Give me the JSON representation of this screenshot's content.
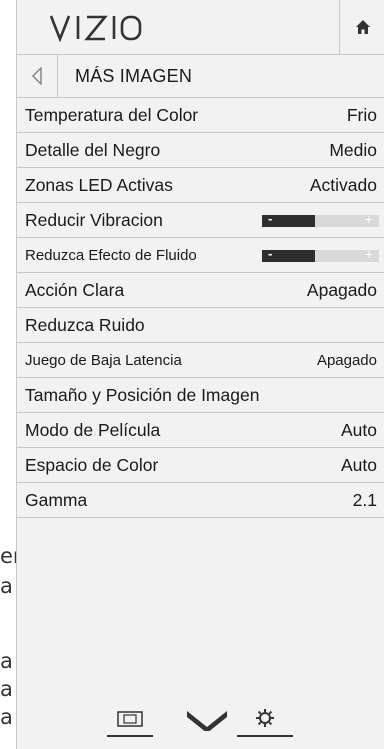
{
  "background_text": [
    "er",
    "a",
    "",
    "a",
    "a",
    "a"
  ],
  "header": {
    "logo_text": "VIZIO",
    "home_icon": "home-icon"
  },
  "subheader": {
    "back_icon": "back-arrow-icon",
    "title": "MÁS IMAGEN"
  },
  "menu": {
    "items": [
      {
        "label": "Temperatura del Color",
        "value": "Frio"
      },
      {
        "label": "Detalle del Negro",
        "value": "Medio"
      },
      {
        "label": "Zonas LED Activas",
        "value": "Activado"
      },
      {
        "label": "Reducir Vibracion",
        "slider": 0.45
      },
      {
        "label": "Reduzca Efecto de Fluido",
        "slider": 0.45
      },
      {
        "label": "Acción Clara",
        "value": "Apagado"
      },
      {
        "label": "Reduzca Ruido",
        "value": ""
      },
      {
        "label": "Juego de Baja Latencia",
        "value": "Apagado"
      },
      {
        "label": "Tamaño y Posición de Imagen",
        "value": ""
      },
      {
        "label": "Modo de Película",
        "value": "Auto"
      },
      {
        "label": "Espacio de Color",
        "value": "Auto"
      },
      {
        "label": "Gamma",
        "value": "2.1"
      }
    ],
    "slider_minus": "-",
    "slider_plus": "+"
  },
  "bottom_nav": {
    "icons": [
      "picture-size-icon",
      "chevron-down-icon",
      "gear-icon"
    ]
  },
  "colors": {
    "panel_bg": "#f2f2f2",
    "divider": "#c8c8c8",
    "slider_fill": "#2e2e2e",
    "slider_track": "#d9d9d9"
  }
}
